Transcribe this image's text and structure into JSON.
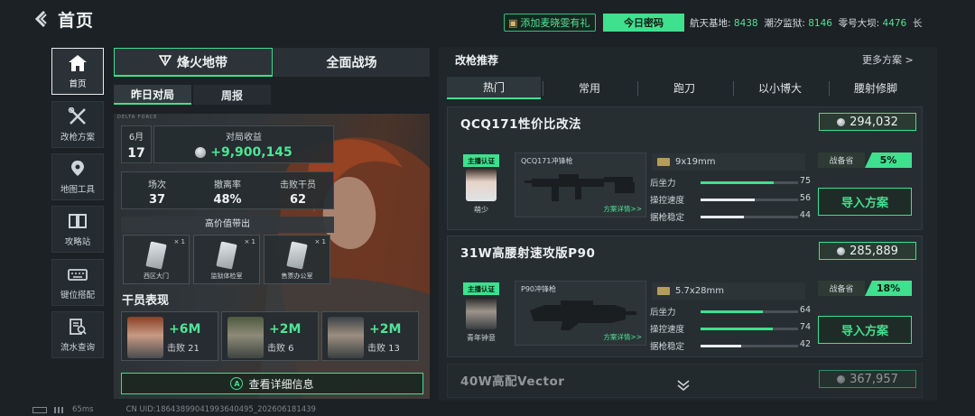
{
  "header": {
    "title": "首页",
    "promo_label": "添加麦晓雯有礼",
    "daily_code_label": "今日密码",
    "codes": [
      {
        "label": "航天基地:",
        "value": "8438"
      },
      {
        "label": "潮汐监狱:",
        "value": "8146"
      },
      {
        "label": "零号大坝:",
        "value": "4476"
      },
      {
        "label": "长",
        "value": ""
      }
    ]
  },
  "sidebar": {
    "items": [
      {
        "label": "首页",
        "icon": "home-icon",
        "active": true
      },
      {
        "label": "改枪方案",
        "icon": "tools-icon",
        "active": false
      },
      {
        "label": "地图工具",
        "icon": "map-pin-icon",
        "active": false
      },
      {
        "label": "攻略站",
        "icon": "book-icon",
        "active": false
      },
      {
        "label": "键位搭配",
        "icon": "keyboard-icon",
        "active": false
      },
      {
        "label": "流水查询",
        "icon": "record-search-icon",
        "active": false
      }
    ]
  },
  "modes": {
    "active": "烽火地带",
    "inactive": "全面战场"
  },
  "subtabs": {
    "active": "昨日对局",
    "inactive": "周报"
  },
  "summary": {
    "hero_caption": "DELTA FORCE",
    "month": "6月",
    "day": "17",
    "income_label": "对局收益",
    "income_value": "+9,900,145",
    "stats": [
      {
        "label": "场次",
        "value": "37"
      },
      {
        "label": "撤离率",
        "value": "48%"
      },
      {
        "label": "击败干员",
        "value": "62"
      }
    ],
    "high_value_title": "高价值带出",
    "high_value_items": [
      {
        "name": "西区大门",
        "count": "1"
      },
      {
        "name": "监狱体检室",
        "count": "1"
      },
      {
        "name": "售票办公室",
        "count": "1"
      }
    ],
    "operator_title": "干员表现",
    "operators": [
      {
        "gain": "+6M",
        "kills": "击败 21"
      },
      {
        "gain": "+2M",
        "kills": "击败 6"
      },
      {
        "gain": "+2M",
        "kills": "击败 13"
      }
    ],
    "detail_button": "查看详细信息"
  },
  "recommend": {
    "title": "改枪推荐",
    "more": "更多方案 >",
    "tabs": [
      "热门",
      "常用",
      "跑刀",
      "以小博大",
      "腰射修脚"
    ],
    "builds": [
      {
        "title": "QCQ171性价比改法",
        "price": "294,032",
        "badge": "主播认证",
        "streamer": "萌少",
        "gun_name": "QCQ171冲锋枪",
        "detail": "方案详情>>",
        "ammo": "9x19mm",
        "stats": [
          {
            "label": "后坐力",
            "value": 75,
            "color": "#3fe08e"
          },
          {
            "label": "操控速度",
            "value": 56,
            "color": "#e8ecee"
          },
          {
            "label": "据枪稳定",
            "value": 44,
            "color": "#e8ecee"
          }
        ],
        "ready_label": "战备省",
        "ready_value": "5%",
        "import_label": "导入方案"
      },
      {
        "title": "31W高腰射速攻版P90",
        "price": "285,889",
        "badge": "主播认证",
        "streamer": "青年钟意",
        "gun_name": "P90冲锋枪",
        "detail": "方案详情>>",
        "ammo": "5.7x28mm",
        "stats": [
          {
            "label": "后坐力",
            "value": 64,
            "color": "#3fe08e"
          },
          {
            "label": "操控速度",
            "value": 74,
            "color": "#3fe08e"
          },
          {
            "label": "据枪稳定",
            "value": 42,
            "color": "#e8ecee"
          }
        ],
        "ready_label": "战备省",
        "ready_value": "18%",
        "import_label": "导入方案"
      },
      {
        "title": "40W高配Vector",
        "price": "367,957"
      }
    ]
  },
  "status_bar": {
    "ping": "65ms",
    "uid": "CN UID:18643899041993640495_202606181439"
  }
}
